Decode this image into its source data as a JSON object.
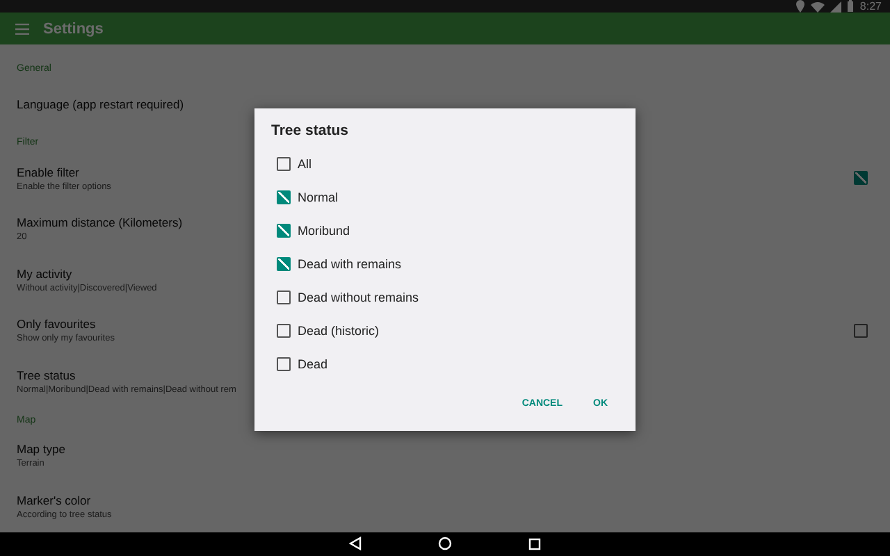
{
  "status_bar": {
    "time": "8:27"
  },
  "toolbar": {
    "title": "Settings"
  },
  "settings": [
    {
      "kind": "header",
      "title": "General"
    },
    {
      "kind": "pref",
      "title": "Language (app restart required)"
    },
    {
      "kind": "header",
      "title": "Filter"
    },
    {
      "kind": "check",
      "title": "Enable filter",
      "summary": "Enable the filter options",
      "checked": true
    },
    {
      "kind": "pref",
      "title": "Maximum distance (Kilometers)",
      "summary": "20"
    },
    {
      "kind": "pref",
      "title": "My activity",
      "summary": "Without activity|Discovered|Viewed"
    },
    {
      "kind": "check",
      "title": "Only favourites",
      "summary": "Show only my favourites",
      "checked": false
    },
    {
      "kind": "pref",
      "title": "Tree status",
      "summary": "Normal|Moribund|Dead with remains|Dead without rem"
    },
    {
      "kind": "header",
      "title": "Map"
    },
    {
      "kind": "pref",
      "title": "Map type",
      "summary": "Terrain"
    },
    {
      "kind": "pref",
      "title": "Marker's color",
      "summary": "According to tree status"
    }
  ],
  "dialog": {
    "title": "Tree status",
    "options": [
      {
        "label": "All",
        "checked": false
      },
      {
        "label": "Normal",
        "checked": true
      },
      {
        "label": "Moribund",
        "checked": true
      },
      {
        "label": "Dead with remains",
        "checked": true
      },
      {
        "label": "Dead without remains",
        "checked": false
      },
      {
        "label": "Dead (historic)",
        "checked": false
      },
      {
        "label": "Dead",
        "checked": false
      }
    ],
    "buttons": [
      "CANCEL",
      "OK"
    ]
  }
}
